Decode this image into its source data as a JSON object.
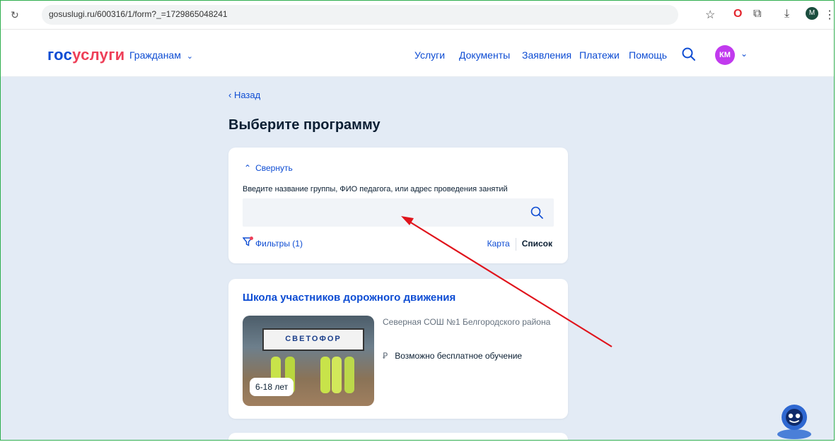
{
  "browser": {
    "url": "gosuslugi.ru/600316/1/form?_=1729865048241",
    "profile": "M"
  },
  "header": {
    "logo_part1": "гос",
    "logo_part2": "услуги",
    "citizens": "Гражданам",
    "nav": [
      "Услуги",
      "Документы",
      "Заявления",
      "Платежи",
      "Помощь"
    ],
    "avatar_initials": "КМ"
  },
  "page": {
    "back": "‹ Назад",
    "title": "Выберите программу"
  },
  "search_card": {
    "collapse": "Свернуть",
    "hint": "Введите название группы, ФИО педагога, или адрес проведения занятий",
    "search_value": "",
    "filters": "Фильтры (1)",
    "map": "Карта",
    "list": "Список"
  },
  "program": {
    "title": "Школа участников дорожного движения",
    "age": "6-18 лет",
    "school": "Северная СОШ №1 Белгородского района",
    "free": "Возможно бесплатное обучение",
    "board_text": "СВЕТОФОР"
  },
  "colors": {
    "accent": "#0d4cd3",
    "brand_red": "#ee3f58",
    "page_bg": "#e3ebf5",
    "annotation_arrow": "#e0141c"
  }
}
